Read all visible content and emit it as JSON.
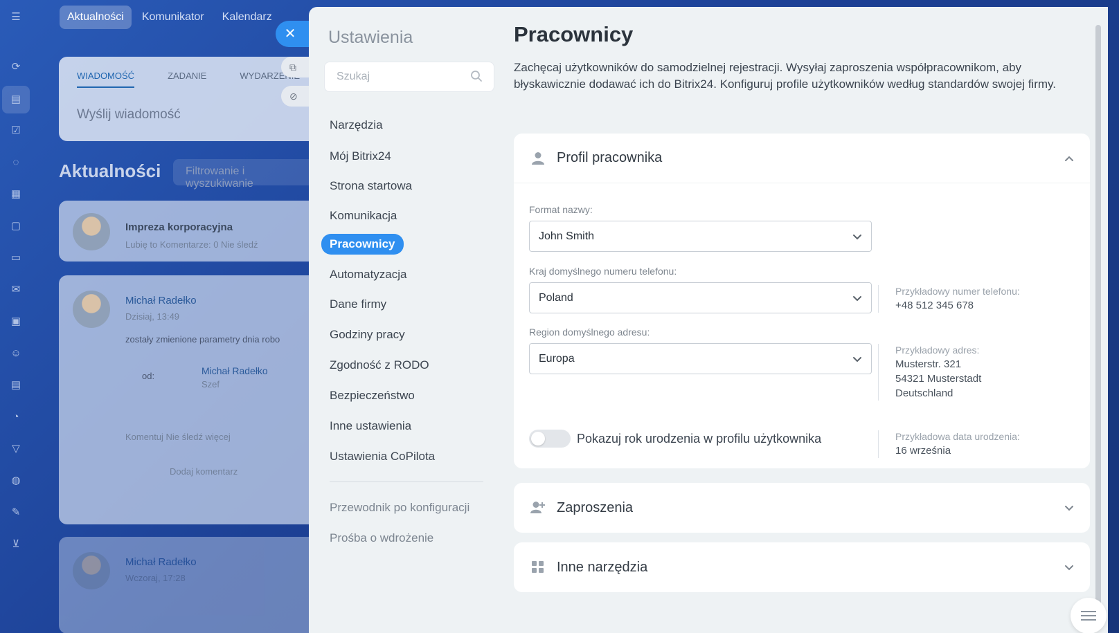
{
  "app": {
    "topnav": [
      "Aktualności",
      "Komunikator",
      "Kalendarz"
    ],
    "post_tabs": [
      "WIADOMOŚĆ",
      "ZADANIE",
      "WYDARZENIE"
    ],
    "post_placeholder": "Wyślij wiadomość",
    "feed_title": "Aktualności",
    "feed_filter_placeholder": "Filtrowanie i wyszukiwanie",
    "feed_items": [
      {
        "name": "Impreza korporacyjna",
        "meta": "Lubię to   Komentarze: 0   Nie śledź"
      },
      {
        "name": "Michał Radełko",
        "meta": "Dzisiaj, 13:49",
        "text": "zostały zmienione parametry dnia robo",
        "from_label": "od:",
        "from_name": "Michał Radełko",
        "from_role": "Szef",
        "actions": "Komentuj   Nie śledź   więcej",
        "comment_placeholder": "Dodaj komentarz"
      },
      {
        "name": "Michał Radełko",
        "meta": "Wczoraj, 17:28"
      }
    ]
  },
  "settings": {
    "title": "Ustawienia",
    "search_placeholder": "Szukaj",
    "nav_items": [
      "Narzędzia",
      "Mój Bitrix24",
      "Strona startowa",
      "Komunikacja",
      "Pracownicy",
      "Automatyzacja",
      "Dane firmy",
      "Godziny pracy",
      "Zgodność z RODO",
      "Bezpieczeństwo",
      "Inne ustawienia",
      "Ustawienia CoPilota"
    ],
    "active_item": "Pracownicy",
    "secondary_items": [
      "Przewodnik po konfiguracji",
      "Prośba o wdrożenie"
    ]
  },
  "page": {
    "title": "Pracownicy",
    "description": "Zachęcaj użytkowników do samodzielnej rejestracji. Wysyłaj zaproszenia współpracownikom, aby błyskawicznie dodawać ich do Bitrix24. Konfiguruj profile użytkowników według standardów swojej firmy.",
    "profile_section": {
      "title": "Profil pracownika",
      "name_format": {
        "label": "Format nazwy:",
        "value": "John Smith"
      },
      "phone_country": {
        "label": "Kraj domyślnego numeru telefonu:",
        "value": "Poland",
        "hint_label": "Przykładowy numer telefonu:",
        "hint_value": "+48 512 345 678"
      },
      "address_region": {
        "label": "Region domyślnego adresu:",
        "value": "Europa",
        "hint_label": "Przykładowy adres:",
        "hint_lines": [
          "Musterstr. 321",
          "54321 Musterstadt",
          "Deutschland"
        ]
      },
      "birth_year_toggle": {
        "label": "Pokazuj rok urodzenia w profilu użytkownika",
        "enabled": false,
        "hint_label": "Przykładowa data urodzenia:",
        "hint_value": "16 września"
      }
    },
    "invitations_section": {
      "title": "Zaproszenia"
    },
    "other_tools_section": {
      "title": "Inne narzędzia"
    }
  },
  "colors": {
    "accent": "#2f8ff0",
    "panel_bg": "#eef2f4",
    "background_blue": "#1d4196"
  }
}
